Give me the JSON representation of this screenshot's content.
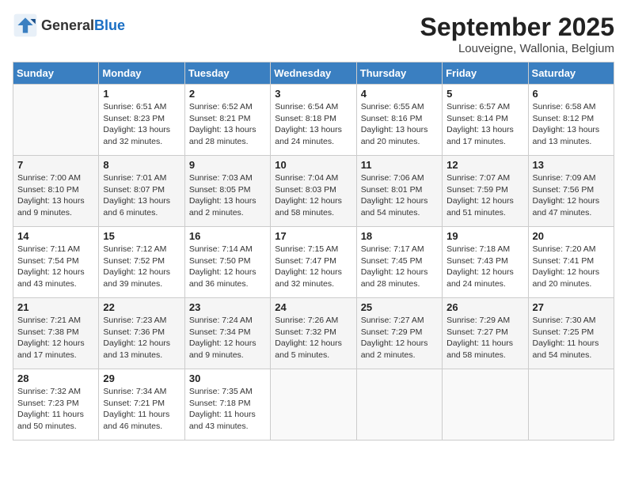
{
  "logo": {
    "general": "General",
    "blue": "Blue"
  },
  "title": "September 2025",
  "location": "Louveigne, Wallonia, Belgium",
  "days_of_week": [
    "Sunday",
    "Monday",
    "Tuesday",
    "Wednesday",
    "Thursday",
    "Friday",
    "Saturday"
  ],
  "weeks": [
    [
      {
        "day": "",
        "info": ""
      },
      {
        "day": "1",
        "info": "Sunrise: 6:51 AM\nSunset: 8:23 PM\nDaylight: 13 hours and 32 minutes."
      },
      {
        "day": "2",
        "info": "Sunrise: 6:52 AM\nSunset: 8:21 PM\nDaylight: 13 hours and 28 minutes."
      },
      {
        "day": "3",
        "info": "Sunrise: 6:54 AM\nSunset: 8:18 PM\nDaylight: 13 hours and 24 minutes."
      },
      {
        "day": "4",
        "info": "Sunrise: 6:55 AM\nSunset: 8:16 PM\nDaylight: 13 hours and 20 minutes."
      },
      {
        "day": "5",
        "info": "Sunrise: 6:57 AM\nSunset: 8:14 PM\nDaylight: 13 hours and 17 minutes."
      },
      {
        "day": "6",
        "info": "Sunrise: 6:58 AM\nSunset: 8:12 PM\nDaylight: 13 hours and 13 minutes."
      }
    ],
    [
      {
        "day": "7",
        "info": "Sunrise: 7:00 AM\nSunset: 8:10 PM\nDaylight: 13 hours and 9 minutes."
      },
      {
        "day": "8",
        "info": "Sunrise: 7:01 AM\nSunset: 8:07 PM\nDaylight: 13 hours and 6 minutes."
      },
      {
        "day": "9",
        "info": "Sunrise: 7:03 AM\nSunset: 8:05 PM\nDaylight: 13 hours and 2 minutes."
      },
      {
        "day": "10",
        "info": "Sunrise: 7:04 AM\nSunset: 8:03 PM\nDaylight: 12 hours and 58 minutes."
      },
      {
        "day": "11",
        "info": "Sunrise: 7:06 AM\nSunset: 8:01 PM\nDaylight: 12 hours and 54 minutes."
      },
      {
        "day": "12",
        "info": "Sunrise: 7:07 AM\nSunset: 7:59 PM\nDaylight: 12 hours and 51 minutes."
      },
      {
        "day": "13",
        "info": "Sunrise: 7:09 AM\nSunset: 7:56 PM\nDaylight: 12 hours and 47 minutes."
      }
    ],
    [
      {
        "day": "14",
        "info": "Sunrise: 7:11 AM\nSunset: 7:54 PM\nDaylight: 12 hours and 43 minutes."
      },
      {
        "day": "15",
        "info": "Sunrise: 7:12 AM\nSunset: 7:52 PM\nDaylight: 12 hours and 39 minutes."
      },
      {
        "day": "16",
        "info": "Sunrise: 7:14 AM\nSunset: 7:50 PM\nDaylight: 12 hours and 36 minutes."
      },
      {
        "day": "17",
        "info": "Sunrise: 7:15 AM\nSunset: 7:47 PM\nDaylight: 12 hours and 32 minutes."
      },
      {
        "day": "18",
        "info": "Sunrise: 7:17 AM\nSunset: 7:45 PM\nDaylight: 12 hours and 28 minutes."
      },
      {
        "day": "19",
        "info": "Sunrise: 7:18 AM\nSunset: 7:43 PM\nDaylight: 12 hours and 24 minutes."
      },
      {
        "day": "20",
        "info": "Sunrise: 7:20 AM\nSunset: 7:41 PM\nDaylight: 12 hours and 20 minutes."
      }
    ],
    [
      {
        "day": "21",
        "info": "Sunrise: 7:21 AM\nSunset: 7:38 PM\nDaylight: 12 hours and 17 minutes."
      },
      {
        "day": "22",
        "info": "Sunrise: 7:23 AM\nSunset: 7:36 PM\nDaylight: 12 hours and 13 minutes."
      },
      {
        "day": "23",
        "info": "Sunrise: 7:24 AM\nSunset: 7:34 PM\nDaylight: 12 hours and 9 minutes."
      },
      {
        "day": "24",
        "info": "Sunrise: 7:26 AM\nSunset: 7:32 PM\nDaylight: 12 hours and 5 minutes."
      },
      {
        "day": "25",
        "info": "Sunrise: 7:27 AM\nSunset: 7:29 PM\nDaylight: 12 hours and 2 minutes."
      },
      {
        "day": "26",
        "info": "Sunrise: 7:29 AM\nSunset: 7:27 PM\nDaylight: 11 hours and 58 minutes."
      },
      {
        "day": "27",
        "info": "Sunrise: 7:30 AM\nSunset: 7:25 PM\nDaylight: 11 hours and 54 minutes."
      }
    ],
    [
      {
        "day": "28",
        "info": "Sunrise: 7:32 AM\nSunset: 7:23 PM\nDaylight: 11 hours and 50 minutes."
      },
      {
        "day": "29",
        "info": "Sunrise: 7:34 AM\nSunset: 7:21 PM\nDaylight: 11 hours and 46 minutes."
      },
      {
        "day": "30",
        "info": "Sunrise: 7:35 AM\nSunset: 7:18 PM\nDaylight: 11 hours and 43 minutes."
      },
      {
        "day": "",
        "info": ""
      },
      {
        "day": "",
        "info": ""
      },
      {
        "day": "",
        "info": ""
      },
      {
        "day": "",
        "info": ""
      }
    ]
  ]
}
